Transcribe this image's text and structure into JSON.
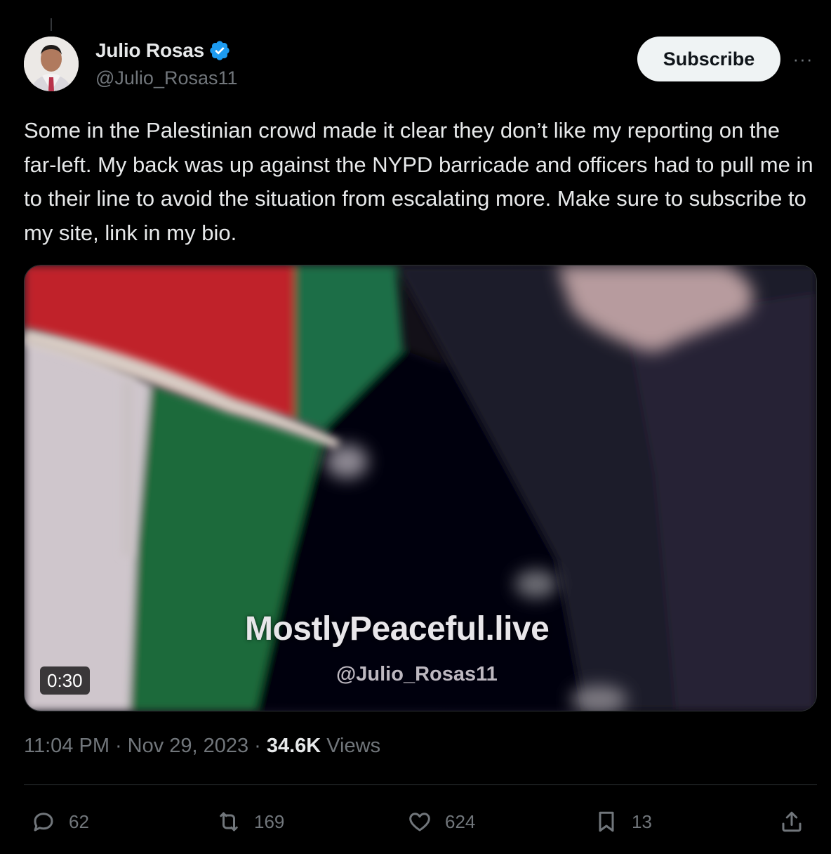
{
  "author": {
    "name": "Julio Rosas",
    "handle": "@Julio_Rosas11",
    "verified": true,
    "subscribe_label": "Subscribe"
  },
  "more_icon": "more-options-icon",
  "tweet_text": "Some in the Palestinian crowd made it clear they don’t like my reporting on the far-left. My back was up against the NYPD barricade and officers had to pull me in to their line to avoid the situation from escalating more. Make sure to subscribe to my site, link in my bio.",
  "media": {
    "watermark_title": "MostlyPeaceful.live",
    "watermark_handle": "@Julio_Rosas11",
    "duration": "0:30"
  },
  "meta": {
    "time": "11:04 PM",
    "separator": "·",
    "date": "Nov 29, 2023",
    "views_count": "34.6K",
    "views_label": "Views"
  },
  "actions": {
    "replies": "62",
    "reposts": "169",
    "likes": "624",
    "bookmarks": "13"
  },
  "colors": {
    "background": "#000000",
    "text": "#e7e9ea",
    "secondary": "#71767b",
    "verified": "#1d9bf0",
    "divider": "#2f3336"
  }
}
